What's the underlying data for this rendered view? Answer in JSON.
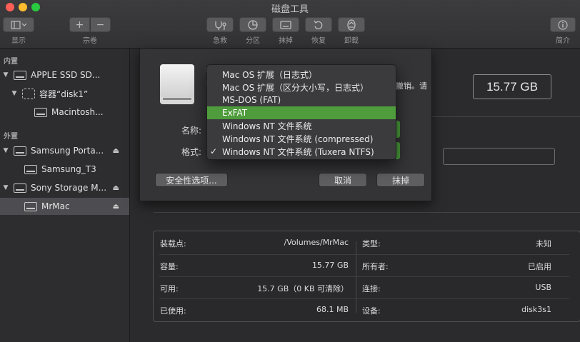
{
  "window": {
    "title": "磁盘工具"
  },
  "toolbar": {
    "view_label": "显示",
    "volume_label": "宗卷",
    "add_icon": "plus-icon",
    "remove_icon": "minus-icon",
    "first_aid_label": "急救",
    "partition_label": "分区",
    "erase_label": "抹掉",
    "restore_label": "恢复",
    "unmount_label": "卸载",
    "info_label": "简介"
  },
  "sidebar": {
    "internal_header": "内置",
    "external_header": "外置",
    "items": [
      {
        "label": "APPLE SSD SD...",
        "kind": "disk"
      },
      {
        "label": "容器“disk1”",
        "kind": "container"
      },
      {
        "label": "Macintosh...",
        "kind": "volume"
      },
      {
        "label": "Samsung Porta...",
        "kind": "disk"
      },
      {
        "label": "Samsung_T3",
        "kind": "volume"
      },
      {
        "label": "Sony Storage M...",
        "kind": "disk"
      },
      {
        "label": "MrMac",
        "kind": "volume",
        "selected": true
      }
    ]
  },
  "main": {
    "capacity": "15.77 GB",
    "info": {
      "rows": [
        {
          "k1": "装载点:",
          "v1": "/Volumes/MrMac",
          "k2": "类型:",
          "v2": "未知"
        },
        {
          "k1": "容量:",
          "v1": "15.77 GB",
          "k2": "所有者:",
          "v2": "已启用"
        },
        {
          "k1": "可用:",
          "v1": "15.7 GB（0 KB 可清除）",
          "k2": "连接:",
          "v2": "USB"
        },
        {
          "k1": "已使用:",
          "v1": "68.1 MB",
          "k2": "设备:",
          "v2": "disk3s1"
        }
      ]
    }
  },
  "sheet": {
    "partial_text_top": "抹",
    "partial_text_mid": "抹",
    "partial_text_right": "撤销。请",
    "name_label": "名称:",
    "format_label": "格式:",
    "security_button": "安全性选项...",
    "cancel_button": "取消",
    "erase_button": "抹掉"
  },
  "format_menu": {
    "options": [
      {
        "label": "Mac OS 扩展（日志式）",
        "checked": false,
        "highlighted": false
      },
      {
        "label": "Mac OS 扩展（区分大小写，日志式）",
        "checked": false,
        "highlighted": false
      },
      {
        "label": "MS-DOS (FAT)",
        "checked": false,
        "highlighted": false
      },
      {
        "label": "ExFAT",
        "checked": false,
        "highlighted": true
      },
      {
        "label": "Windows NT 文件系统",
        "checked": false,
        "highlighted": false
      },
      {
        "label": "Windows NT 文件系统 (compressed)",
        "checked": false,
        "highlighted": false
      },
      {
        "label": "Windows NT 文件系统 (Tuxera NTFS)",
        "checked": true,
        "highlighted": false
      }
    ],
    "check_mark": "✓"
  },
  "colors": {
    "highlight": "#4f9c3c",
    "background": "#2b2b2d"
  }
}
